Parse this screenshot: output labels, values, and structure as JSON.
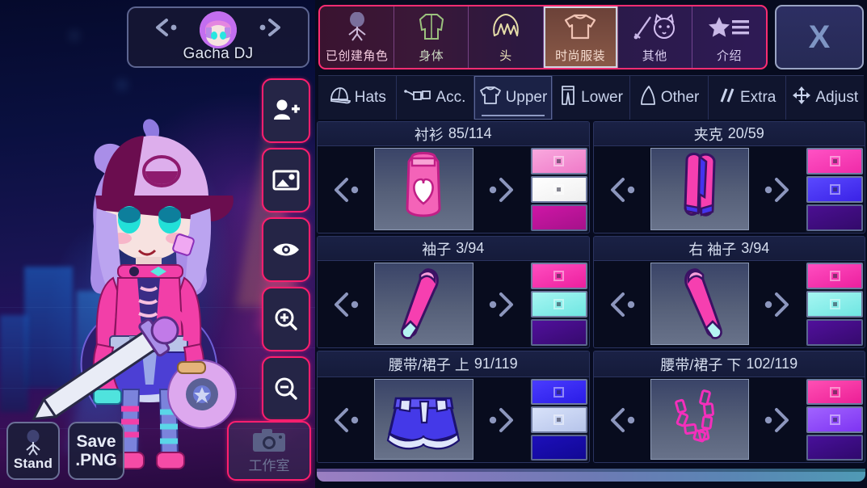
{
  "character": {
    "name": "Gacha DJ",
    "prev_icon": "chevron-left-icon",
    "next_icon": "chevron-right-icon"
  },
  "tools": [
    {
      "name": "add-character",
      "icon": "person-add-icon"
    },
    {
      "name": "background",
      "icon": "image-icon"
    },
    {
      "name": "preview-eye",
      "icon": "eye-icon"
    },
    {
      "name": "zoom-in",
      "icon": "zoom-in-icon"
    },
    {
      "name": "zoom-out",
      "icon": "zoom-out-icon"
    }
  ],
  "bottom_buttons": {
    "stand_label": "Stand",
    "stand_icon": "standing-figure-icon",
    "save_line1": "Save",
    "save_line2": ".PNG",
    "studio_label": "工作室",
    "studio_icon": "camera-icon"
  },
  "category_tabs": [
    {
      "label": "已创建角色",
      "icon": "character-figure-icon",
      "active": false
    },
    {
      "label": "身体",
      "icon": "jacket-body-icon",
      "active": false
    },
    {
      "label": "头",
      "icon": "hair-head-icon",
      "active": false
    },
    {
      "label": "时尚服装",
      "icon": "tshirt-icon",
      "active": true
    },
    {
      "label": "其他",
      "icon": "sword-cat-icon",
      "active": false
    },
    {
      "label": "介绍",
      "icon": "star-list-icon",
      "active": false
    }
  ],
  "close_button": {
    "label": "X",
    "icon": "close-icon"
  },
  "sub_tabs": [
    {
      "label": "Hats",
      "icon": "cap-icon",
      "active": false
    },
    {
      "label": "Acc.",
      "icon": "glasses-icon",
      "active": false
    },
    {
      "label": "Upper",
      "icon": "tshirt-icon",
      "active": true
    },
    {
      "label": "Lower",
      "icon": "pants-icon",
      "active": false
    },
    {
      "label": "Other",
      "icon": "cape-icon",
      "active": false
    },
    {
      "label": "Extra",
      "icon": "slashes-icon",
      "active": false
    },
    {
      "label": "Adjust",
      "icon": "move-arrows-icon",
      "active": false
    }
  ],
  "items": [
    {
      "title": "衬衫",
      "count": "85/114",
      "preview": "pink-tank-top-heart",
      "swatches": [
        "#f58ad4",
        "#f7f7f7",
        "#c4129f"
      ]
    },
    {
      "title": "夹克",
      "count": "20/59",
      "preview": "pink-blue-jacket",
      "swatches": [
        "#f83fb4",
        "#4432f2",
        "#3d0d7a"
      ]
    },
    {
      "title": "袖子",
      "count": "3/94",
      "preview": "pink-sleeve-left",
      "swatches": [
        "#f636b5",
        "#86ece8",
        "#420a85"
      ]
    },
    {
      "title": "右 袖子",
      "count": "3/94",
      "preview": "pink-sleeve-right",
      "swatches": [
        "#f636b5",
        "#86ece8",
        "#420a85"
      ]
    },
    {
      "title": "腰带/裙子 上",
      "count": "91/119",
      "preview": "blue-frilled-skirt",
      "swatches": [
        "#3a2df0",
        "#c3d0ef",
        "#1409a8"
      ]
    },
    {
      "title": "腰带/裙子 下",
      "count": "102/119",
      "preview": "pink-chain-belt",
      "swatches": [
        "#f6399f",
        "#9048f3",
        "#3b0b7e"
      ]
    }
  ],
  "scrollbar": {
    "name": "horizontal-scrollbar"
  }
}
